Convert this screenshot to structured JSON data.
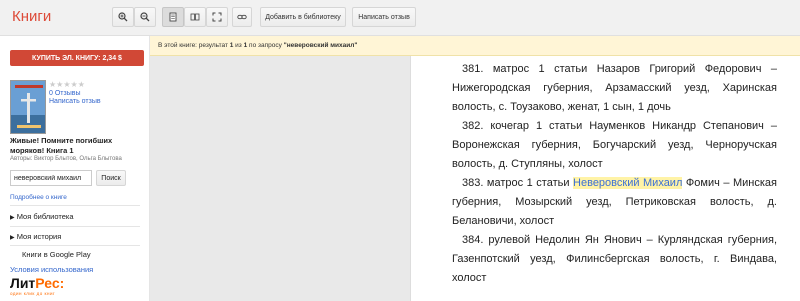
{
  "app": {
    "title": "Книги"
  },
  "toolbar": {
    "add_library": "Добавить в библиотеку",
    "write_review": "Написать отзыв"
  },
  "sidebar": {
    "buy_button": "КУПИТЬ ЭЛ. КНИГУ: 2,34 $",
    "rating_stars": "★★★★★",
    "reviews_count": "0 Отзывы",
    "write_review": "Написать отзыв",
    "book_title": "Живые! Помните погибших моряков! Книга 1",
    "authors": "Авторы: Виктор Блытов, Ольга Блытова",
    "search_value": "неверовский михаил",
    "search_button": "Поиск",
    "more_link": "Подробнее о книге",
    "my_library": "Моя библиотека",
    "my_history": "Моя история",
    "google_play": "Книги в Google Play",
    "terms": "Условия использования",
    "logo_main": "Лит",
    "logo_accent": "Рес:",
    "logo_sub": "один клик до книг"
  },
  "notice": {
    "prefix": "В этой книге: результат",
    "n1": "1",
    "mid1": "из",
    "n2": "1",
    "mid2": "по запросу",
    "query": "\"неверовский михаил\""
  },
  "page_text": {
    "p1": "381. матрос 1 статьи Назаров Григорий Федорович – Нижегородская губерния, Арзамасский уезд, Харинская волость, с. Тоузаково, женат, 1 сын, 1 дочь",
    "p2": "382. кочегар 1 статьи Науменков Никандр Степанович – Воронежская губерния, Богучарский уезд, Черноручская волость, д. Ступляны, холост",
    "p3_before": "383. матрос 1 статьи ",
    "p3_highlight": "Неверовский Михаил",
    "p3_after": " Фомич – Минская губерния, Мозырский уезд, Петриковская волость, д. Белановичи, холост",
    "p4": "384. рулевой Недолин Ян Янович – Курляндская губерния, Газенпотский уезд, Филинсбергская волость, г. Виндава, холост"
  },
  "colors": {
    "brand": "#dd4b39",
    "buy": "#d14836",
    "link": "#3366cc",
    "highlight": "#fff3a6"
  }
}
